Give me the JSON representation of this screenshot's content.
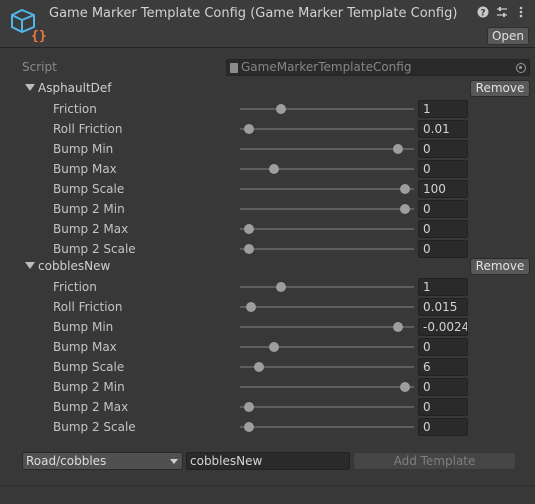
{
  "header": {
    "title": "Game Marker Template Config (Game Marker Template Config)",
    "open_label": "Open",
    "icons": [
      "help-icon",
      "settings-sliders-icon",
      "more-vert-icon"
    ]
  },
  "script": {
    "label": "Script",
    "value": "GameMarkerTemplateConfig"
  },
  "sections": [
    {
      "name": "AsphaultDef",
      "remove_label": "Remove",
      "properties": [
        {
          "label": "Friction",
          "value": "1",
          "slider": 0.22
        },
        {
          "label": "Roll Friction",
          "value": "0.01",
          "slider": 0.03
        },
        {
          "label": "Bump Min",
          "value": "0",
          "slider": 0.93
        },
        {
          "label": "Bump Max",
          "value": "0",
          "slider": 0.18
        },
        {
          "label": "Bump Scale",
          "value": "100",
          "slider": 0.97
        },
        {
          "label": "Bump 2 Min",
          "value": "0",
          "slider": 0.97
        },
        {
          "label": "Bump 2 Max",
          "value": "0",
          "slider": 0.03
        },
        {
          "label": "Bump 2 Scale",
          "value": "0",
          "slider": 0.03
        }
      ]
    },
    {
      "name": "cobblesNew",
      "remove_label": "Remove",
      "properties": [
        {
          "label": "Friction",
          "value": "1",
          "slider": 0.22
        },
        {
          "label": "Roll Friction",
          "value": "0.015",
          "slider": 0.04
        },
        {
          "label": "Bump Min",
          "value": "-0.0024",
          "slider": 0.93
        },
        {
          "label": "Bump Max",
          "value": "0",
          "slider": 0.18
        },
        {
          "label": "Bump Scale",
          "value": "6",
          "slider": 0.09
        },
        {
          "label": "Bump 2 Min",
          "value": "0",
          "slider": 0.97
        },
        {
          "label": "Bump 2 Max",
          "value": "0",
          "slider": 0.03
        },
        {
          "label": "Bump 2 Scale",
          "value": "0",
          "slider": 0.03
        }
      ]
    }
  ],
  "footer": {
    "dropdown_value": "Road/cobbles",
    "name_value": "cobblesNew",
    "add_label": "Add Template"
  }
}
